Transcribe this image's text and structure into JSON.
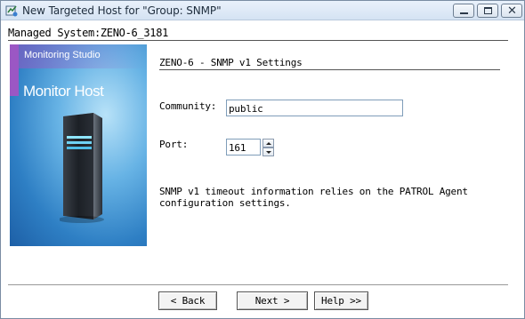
{
  "window": {
    "title": "New Targeted Host for \"Group: SNMP\"",
    "controls": {
      "minimize": "minimize",
      "maximize": "maximize",
      "close": "✕"
    }
  },
  "header": {
    "managed_system": "Managed System:ZENO-6_3181"
  },
  "splash": {
    "subtitle": "Monitoring Studio",
    "title": "Monitor Host",
    "accent_color": "#9b57c4",
    "background_color": "#2e7fc4"
  },
  "settings": {
    "section_title": "ZENO-6 - SNMP v1 Settings",
    "community_label": "Community:",
    "community_value": "public",
    "port_label": "Port:",
    "port_value": "161",
    "info_text": "SNMP v1 timeout information relies on the PATROL Agent configuration settings."
  },
  "buttons": {
    "back": "< Back",
    "next": "Next >",
    "help": "Help >>"
  }
}
